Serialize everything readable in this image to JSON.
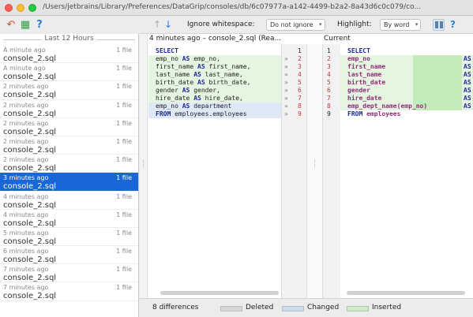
{
  "window": {
    "title": "/Users/jetbrains/Library/Preferences/DataGrip/consoles/db/6c07977a-a142-4499-b2a2-8a43d6c0c079/co..."
  },
  "history": {
    "group_label": "Last 12 Hours",
    "items": [
      {
        "ago": "A minute ago",
        "count": "1 file",
        "file": "console_2.sql"
      },
      {
        "ago": "A minute ago",
        "count": "1 file",
        "file": "console_2.sql"
      },
      {
        "ago": "2 minutes ago",
        "count": "1 file",
        "file": "console_2.sql"
      },
      {
        "ago": "2 minutes ago",
        "count": "1 file",
        "file": "console_2.sql"
      },
      {
        "ago": "2 minutes ago",
        "count": "1 file",
        "file": "console_2.sql"
      },
      {
        "ago": "2 minutes ago",
        "count": "1 file",
        "file": "console_2.sql"
      },
      {
        "ago": "2 minutes ago",
        "count": "1 file",
        "file": "console_2.sql"
      },
      {
        "ago": "3 minutes ago",
        "count": "1 file",
        "file": "console_2.sql"
      },
      {
        "ago": "4 minutes ago",
        "count": "1 file",
        "file": "console_2.sql"
      },
      {
        "ago": "4 minutes ago",
        "count": "1 file",
        "file": "console_2.sql"
      },
      {
        "ago": "5 minutes ago",
        "count": "1 file",
        "file": "console_2.sql"
      },
      {
        "ago": "6 minutes ago",
        "count": "1 file",
        "file": "console_2.sql"
      },
      {
        "ago": "7 minutes ago",
        "count": "1 file",
        "file": "console_2.sql"
      },
      {
        "ago": "7 minutes ago",
        "count": "1 file",
        "file": "console_2.sql"
      }
    ],
    "selected_index": 7
  },
  "diff_toolbar": {
    "ignore_label": "Ignore whitespace:",
    "ignore_value": "Do not ignore",
    "highlight_label": "Highlight:",
    "highlight_value": "By word",
    "help": "?"
  },
  "left_pane": {
    "header": "4 minutes ago – console_2.sql (Rea...",
    "lines": [
      {
        "kw1": "SELECT",
        "a": "",
        "kw2": "",
        "b": ""
      },
      {
        "kw1": "",
        "a": "emp_no",
        "kw2": "AS",
        "b": "emp_no,"
      },
      {
        "kw1": "",
        "a": "first_name",
        "kw2": "AS",
        "b": "first_name,"
      },
      {
        "kw1": "",
        "a": "last_name",
        "kw2": "AS",
        "b": "last_name,"
      },
      {
        "kw1": "",
        "a": "birth_date",
        "kw2": "AS",
        "b": "birth_date,"
      },
      {
        "kw1": "",
        "a": "gender",
        "kw2": "AS",
        "b": "gender,"
      },
      {
        "kw1": "",
        "a": "hire_date",
        "kw2": "AS",
        "b": "hire_date,"
      },
      {
        "kw1": "",
        "a": "emp_no",
        "kw2": "AS",
        "b": "department"
      },
      {
        "kw1": "FROM",
        "a": "employees.employees",
        "kw2": "",
        "b": ""
      }
    ],
    "line_numbers": [
      "1",
      "2",
      "3",
      "4",
      "5",
      "6",
      "7",
      "8",
      "9"
    ]
  },
  "right_pane": {
    "header": "Current",
    "lines": [
      {
        "kw1": "SELECT",
        "a": "",
        "kw2": ""
      },
      {
        "kw1": "",
        "a": "emp_no",
        "kw2": "AS"
      },
      {
        "kw1": "",
        "a": "first_name",
        "kw2": "AS"
      },
      {
        "kw1": "",
        "a": "last_name",
        "kw2": "AS"
      },
      {
        "kw1": "",
        "a": "birth_date",
        "kw2": "AS"
      },
      {
        "kw1": "",
        "a": "gender",
        "kw2": "AS"
      },
      {
        "kw1": "",
        "a": "hire_date",
        "kw2": "AS"
      },
      {
        "kw1": "",
        "a": "emp_dept_name(emp_no)",
        "kw2": "AS"
      },
      {
        "kw1": "FROM",
        "a": "employees",
        "kw2": ""
      }
    ],
    "line_numbers": [
      "1",
      "2",
      "3",
      "4",
      "5",
      "6",
      "7",
      "8",
      "9"
    ]
  },
  "status": {
    "differences": "8 differences",
    "deleted": "Deleted",
    "changed": "Changed",
    "inserted": "Inserted"
  },
  "colors": {
    "selection": "#1966d6",
    "changed": "#dfe8f7",
    "inserted": "#e6f5e1",
    "deleted_swatch": "#d6d6d6",
    "changed_swatch": "#cbdcf5",
    "inserted_swatch": "#c9efc0"
  },
  "icons": {
    "undo": "undo-icon",
    "refresh": "refresh-icon",
    "help": "help-icon",
    "up": "arrow-up-icon",
    "down": "arrow-down-icon",
    "layout": "side-by-side-icon"
  }
}
